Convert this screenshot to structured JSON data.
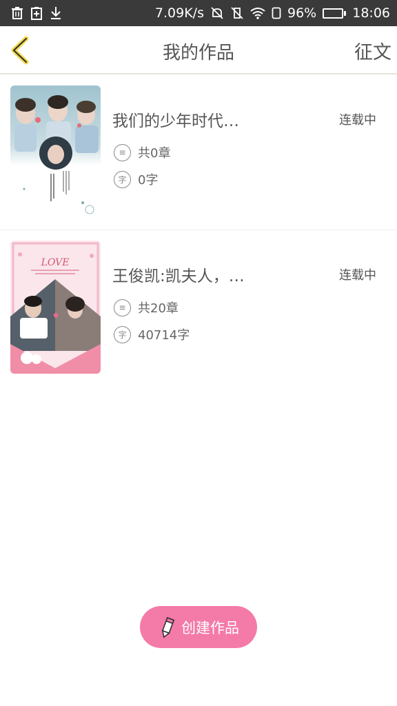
{
  "status_bar": {
    "left_icons": [
      "trash-icon",
      "add-doc-icon",
      "download-icon"
    ],
    "speed": "7.09K/s",
    "battery_percent": "96%",
    "time": "18:06",
    "battery_level": 0.96,
    "battery_color": "#f4b400"
  },
  "header": {
    "title": "我的作品",
    "right_action": "征文",
    "back_icon_color": "#f0d84a"
  },
  "works": [
    {
      "title": "我们的少年时代…",
      "status": "连载中",
      "chapters": "共0章",
      "words": "0字"
    },
    {
      "title": "王俊凯:凯夫人，…",
      "status": "连载中",
      "chapters": "共20章",
      "words": "40714字"
    }
  ],
  "cover2_text": "LOVE",
  "create_button": {
    "label": "创建作品",
    "color": "#f47aa8"
  },
  "icons": {
    "chapter_icon_glyph": "≡",
    "word_icon_glyph": "字"
  }
}
